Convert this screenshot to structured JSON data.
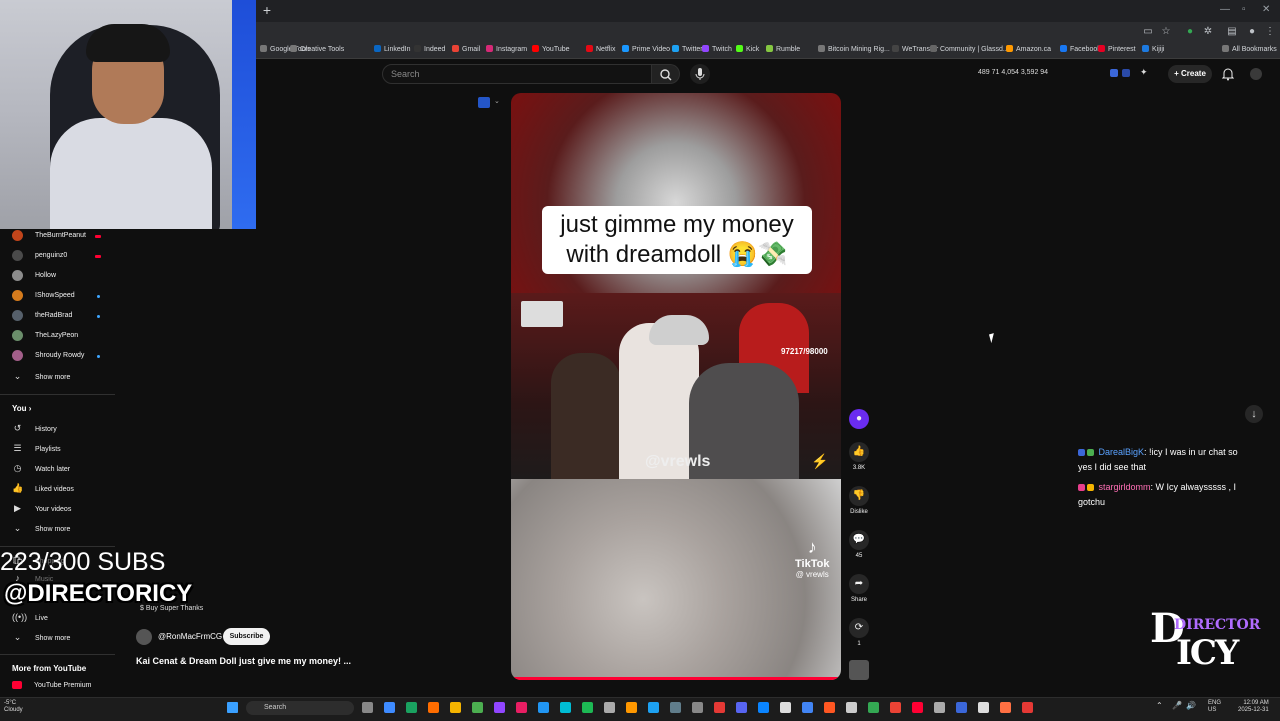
{
  "bookmarks": [
    "Google Tools",
    "Creative Tools",
    "LinkedIn",
    "Indeed",
    "Gmail",
    "Instagram",
    "YouTube",
    "Netflix",
    "Prime Video",
    "Twitter",
    "Twitch",
    "Kick",
    "Rumble",
    "Bitcoin Mining Rig...",
    "WeTransfer",
    "Community | Glassd...",
    "Amazon.ca",
    "Facebook",
    "Pinterest",
    "Kijiji",
    "All Bookmarks"
  ],
  "bookmark_colors": [
    "#777",
    "#777",
    "#0a66c2",
    "#333",
    "#ea4335",
    "#d62976",
    "#ff0000",
    "#e50914",
    "#1a98ff",
    "#1da1f2",
    "#9146ff",
    "#53fc18",
    "#85c742",
    "#777",
    "#444",
    "#666",
    "#ff9900",
    "#1877f2",
    "#e60023",
    "#1d7ae0",
    "#777"
  ],
  "header": {
    "search_placeholder": "Search",
    "stats": "489  71  4,054  3,592  94",
    "create_label": "Create"
  },
  "sidebar": {
    "subscriptions": [
      {
        "name": "TheBurntPeanut",
        "color": "#c1451b",
        "mark": "live"
      },
      {
        "name": "penguinz0",
        "color": "#4a4a4a",
        "mark": "live"
      },
      {
        "name": "Hollow",
        "color": "#8c8c8c",
        "mark": ""
      },
      {
        "name": "IShowSpeed",
        "color": "#d57b1d",
        "mark": "dot"
      },
      {
        "name": "theRadBrad",
        "color": "#56606b",
        "mark": "dot"
      },
      {
        "name": "TheLazyPeon",
        "color": "#6b8e6b",
        "mark": ""
      },
      {
        "name": "Shroudy Rowdy",
        "color": "#a35f8a",
        "mark": "dot"
      }
    ],
    "show_more": "Show more",
    "you_label": "You",
    "you_items": [
      "History",
      "Playlists",
      "Watch later",
      "Liked videos",
      "Your videos"
    ],
    "you_show_more": "Show more",
    "explore_partial": [
      "Shopping",
      "Music"
    ],
    "live_label": "Live",
    "explore_show_more": "Show more",
    "more_header": "More from YouTube",
    "premium": "YouTube Premium"
  },
  "overlay": {
    "subs_goal": "223/300 SUBS",
    "handle": "@DIRECTORICY",
    "logo_line1": "DIRECTOR",
    "logo_line2": "ICY"
  },
  "chat": [
    {
      "user": "DarealBigK",
      "message": ": !icy I was in ur chat so yes I did see that"
    },
    {
      "user": "stargirldomm",
      "message": ": W Icy alwaysssss , I gotchu"
    }
  ],
  "short": {
    "caption_line1": "just gimme my money",
    "caption_line2": "with dreamdoll 😭💸",
    "counter": "97217/98000",
    "watermark": "@vrewls",
    "tiktok": "TikTok",
    "tiktok_handle": "@ vrewls"
  },
  "actions": {
    "likes": "3.8K",
    "dislike": "Dislike",
    "comments": "45",
    "share": "Share",
    "remix": "1"
  },
  "video_info": {
    "buy_thanks": "Buy Super Thanks",
    "channel": "@RonMacFrmCG",
    "subscribe": "Subscribe",
    "title": "Kai Cenat & Dream Doll just give me my money! ..."
  },
  "taskbar": {
    "weather_temp": "-5°C",
    "weather_desc": "Cloudy",
    "search": "Search",
    "lang1": "ENG",
    "lang2": "US",
    "time": "12:09 AM",
    "date": "2025-12-31"
  }
}
